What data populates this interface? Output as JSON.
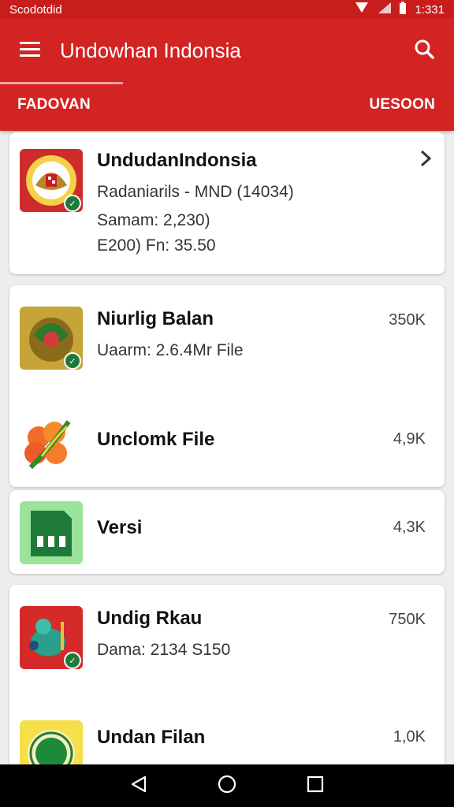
{
  "status_bar": {
    "left_text": "Scodotdid",
    "time": "1:331"
  },
  "app_bar": {
    "title": "Undowhan Indonsia"
  },
  "tabs": [
    {
      "label": "FADOVAN",
      "active": true
    },
    {
      "label": "UESOON",
      "active": false
    }
  ],
  "featured": {
    "name": "UndudanIndonsia",
    "line1": "Radaniarils - MND (14034)",
    "line2": "Samam: 2,230)",
    "line3": "E200) Fn: 35.50"
  },
  "items": [
    {
      "name": "Niurlig Balan",
      "meta": "Uaarm: 2.6.4Mr File",
      "count": "350K"
    },
    {
      "name": "Unclomk File",
      "meta": "",
      "count": "4,9K"
    },
    {
      "name": "Versi",
      "meta": "",
      "count": "4,3K"
    },
    {
      "name": "Undig Rkau",
      "meta": "Dama: 2134 S150",
      "count": "750K"
    },
    {
      "name": "Undan Filan",
      "meta": "",
      "count": "1,0K"
    }
  ],
  "colors": {
    "primary": "#d32424",
    "status": "#c81d1d",
    "badge": "#1d7a3b"
  },
  "icons": {
    "menu": "hamburger-icon",
    "search": "search-icon",
    "chevron": "chevron-right-icon",
    "nav_back": "back-triangle-icon",
    "nav_home": "home-circle-icon",
    "nav_recents": "recents-square-icon"
  }
}
